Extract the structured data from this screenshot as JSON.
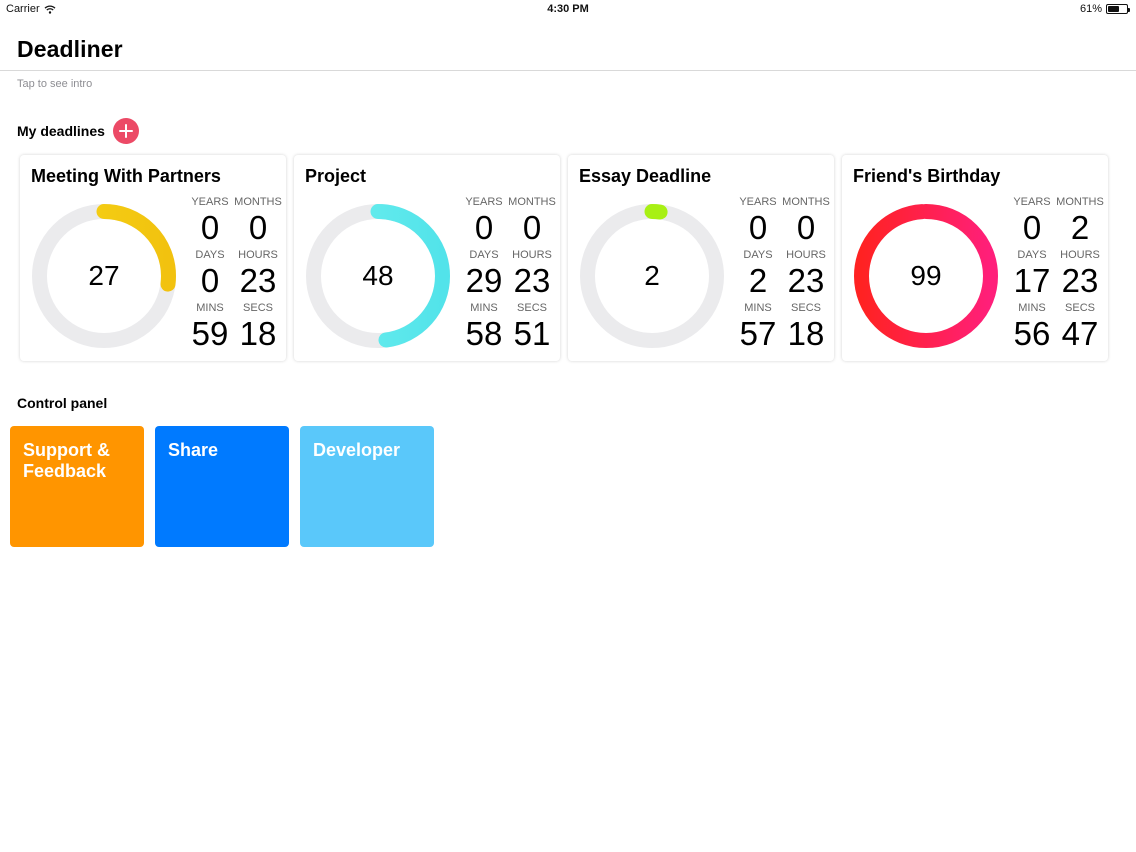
{
  "status_bar": {
    "carrier": "Carrier",
    "time": "4:30 PM",
    "battery": "61%",
    "battery_level": 0.61
  },
  "app": {
    "title": "Deadliner",
    "intro_link": "Tap to see intro"
  },
  "deadlines_section": {
    "label": "My deadlines"
  },
  "stat_labels": {
    "years": "YEARS",
    "months": "MONTHS",
    "days": "DAYS",
    "hours": "HOURS",
    "mins": "MINS",
    "secs": "SECS"
  },
  "deadlines": [
    {
      "title": "Meeting With Partners",
      "percent": "27",
      "progress": 0.27,
      "years": "0",
      "months": "0",
      "days": "0",
      "hours": "23",
      "mins": "59",
      "secs": "18",
      "color_start": "#f5d416",
      "color_end": "#f2c20f"
    },
    {
      "title": "Project",
      "percent": "48",
      "progress": 0.48,
      "years": "0",
      "months": "0",
      "days": "29",
      "hours": "23",
      "mins": "58",
      "secs": "51",
      "color_start": "#6ef0ee",
      "color_end": "#52e3ea"
    },
    {
      "title": "Essay Deadline",
      "percent": "2",
      "progress": 0.02,
      "years": "0",
      "months": "0",
      "days": "2",
      "hours": "23",
      "mins": "57",
      "secs": "18",
      "color_start": "#a8f014",
      "color_end": "#a8f014"
    },
    {
      "title": "Friend's Birthday",
      "percent": "99",
      "progress": 0.99,
      "years": "0",
      "months": "2",
      "days": "17",
      "hours": "23",
      "mins": "56",
      "secs": "47",
      "color_start": "#ff2222",
      "color_end": "#ff1f7a"
    }
  ],
  "control_panel": {
    "label": "Control panel",
    "tiles": [
      {
        "label": "Support & Feedback",
        "color": "#ff9500"
      },
      {
        "label": "Share",
        "color": "#007aff"
      },
      {
        "label": "Developer",
        "color": "#5ac8fa"
      }
    ]
  },
  "colors": {
    "ring_track": "#ebebed",
    "add_button": "#ec4a66"
  }
}
